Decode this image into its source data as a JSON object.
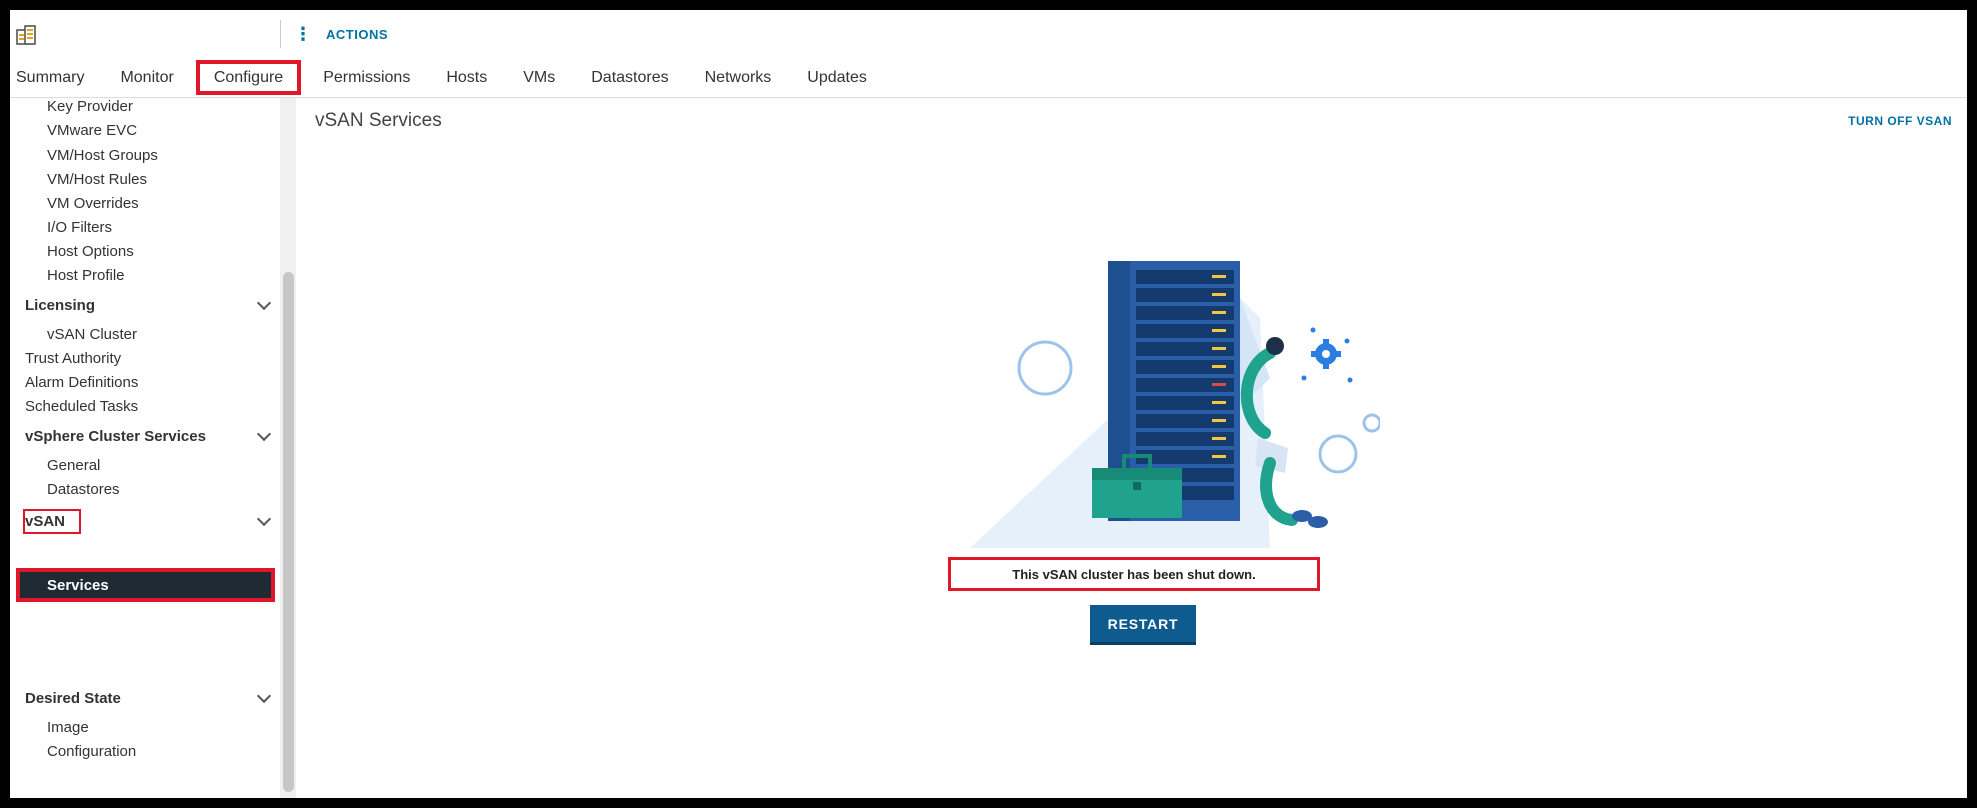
{
  "topbar": {
    "cluster_icon": "cluster-icon",
    "name_value": "",
    "actions_icon": "kebab-icon",
    "actions_label": "ACTIONS"
  },
  "tabs": [
    {
      "label": "Summary",
      "active": false
    },
    {
      "label": "Monitor",
      "active": false
    },
    {
      "label": "Configure",
      "active": true
    },
    {
      "label": "Permissions",
      "active": false
    },
    {
      "label": "Hosts",
      "active": false
    },
    {
      "label": "VMs",
      "active": false
    },
    {
      "label": "Datastores",
      "active": false
    },
    {
      "label": "Networks",
      "active": false
    },
    {
      "label": "Updates",
      "active": false
    }
  ],
  "sidebar": {
    "items": {
      "key_provider": "Key Provider",
      "vmware_evc": "VMware EVC",
      "vm_host_groups": "VM/Host Groups",
      "vm_host_rules": "VM/Host Rules",
      "vm_overrides": "VM Overrides",
      "io_filters": "I/O Filters",
      "host_options": "Host Options",
      "host_profile": "Host Profile",
      "licensing": "Licensing",
      "vsan_cluster": "vSAN Cluster",
      "trust_authority": "Trust Authority",
      "alarm_definitions": "Alarm Definitions",
      "scheduled_tasks": "Scheduled Tasks",
      "vsphere_cluster_services": "vSphere Cluster Services",
      "general": "General",
      "datastores": "Datastores",
      "vsan": "vSAN",
      "services": "Services",
      "desired_state": "Desired State",
      "image": "Image",
      "configuration": "Configuration"
    }
  },
  "main": {
    "title": "vSAN Services",
    "turn_off_label": "TURN OFF VSAN",
    "message": "This vSAN cluster has been shut down.",
    "restart_label": "RESTART",
    "illustration": "server-maintenance-illustration"
  },
  "colors": {
    "accent": "#0072a3",
    "highlight": "#e0162b",
    "selected_bg": "#1f2a33",
    "button_bg": "#0e5c8f",
    "server_blue": "#2b5ea8",
    "toolbox_teal": "#1fa28e"
  }
}
